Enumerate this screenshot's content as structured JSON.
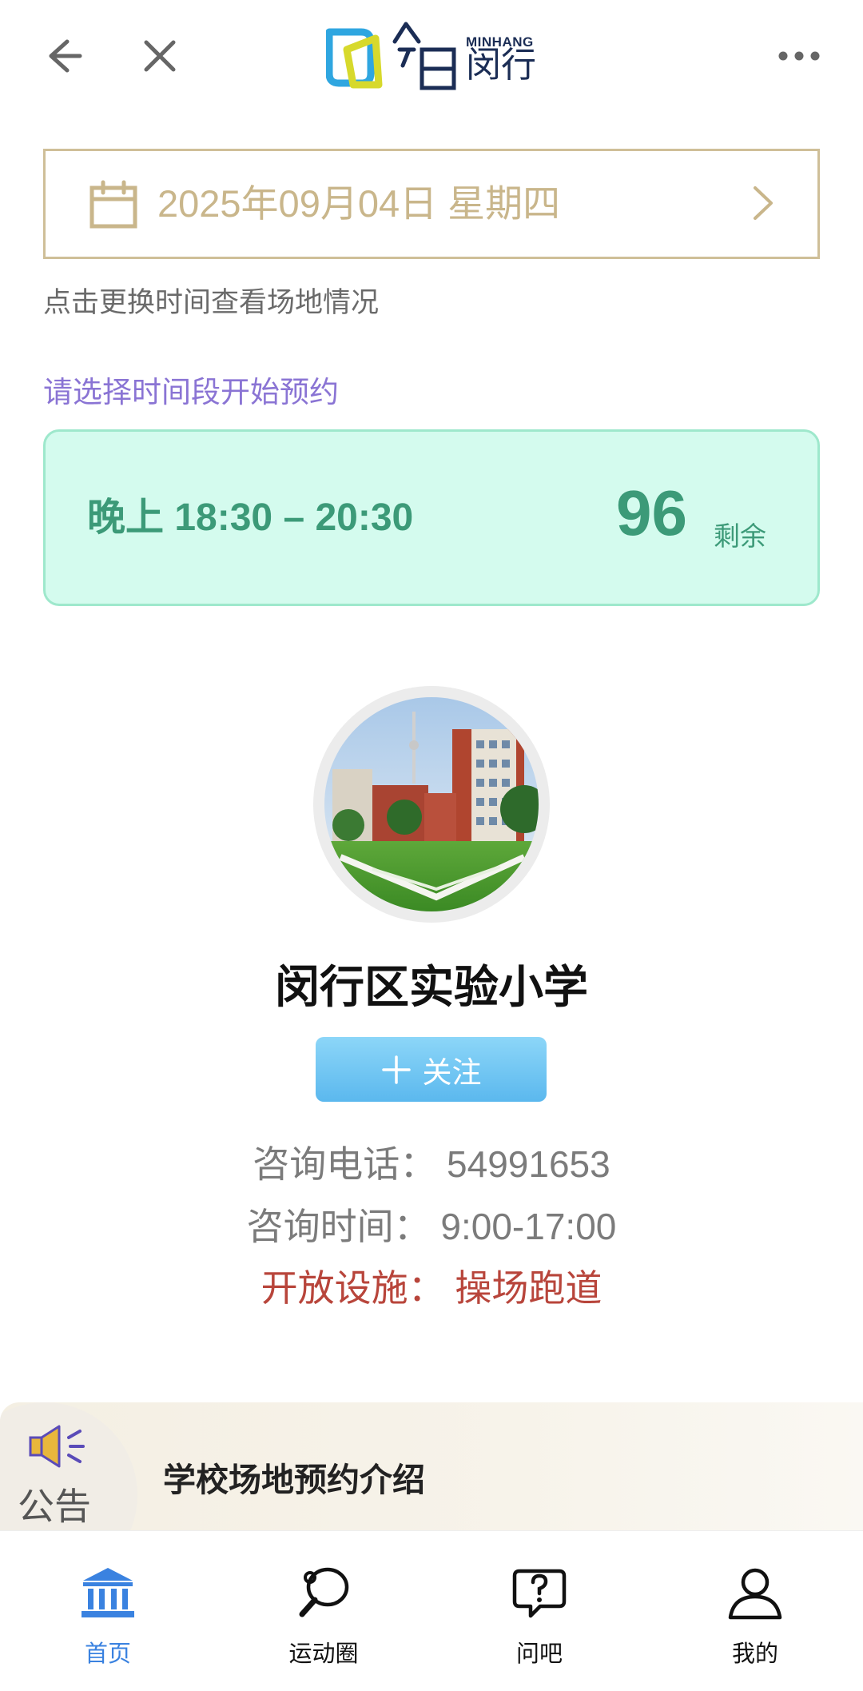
{
  "header": {
    "logo_en": "MINHANG",
    "logo_cn": "闵行",
    "back_icon": "arrow-left-icon",
    "close_icon": "close-icon",
    "more_icon": "more-dots-icon"
  },
  "date_selector": {
    "date_text": "2025年09月04日 星期四",
    "hint": "点击更换时间查看场地情况"
  },
  "booking": {
    "prompt": "请选择时间段开始预约",
    "slot": {
      "time": "晚上 18:30 – 20:30",
      "remaining_count": "96",
      "remaining_label": "剩余"
    }
  },
  "school": {
    "name": "闵行区实验小学",
    "follow_label": "关注",
    "phone": "咨询电话：  54991653",
    "hours": "咨询时间：  9:00-17:00",
    "facilities": "开放设施：  操场跑道"
  },
  "announcement": {
    "label": "公告",
    "text": "学校场地预约介绍",
    "icon": "speaker-icon"
  },
  "tabs": [
    {
      "label": "首页",
      "icon": "bank-icon",
      "active": true
    },
    {
      "label": "运动圈",
      "icon": "ping-pong-icon",
      "active": false
    },
    {
      "label": "问吧",
      "icon": "question-bubble-icon",
      "active": false
    },
    {
      "label": "我的",
      "icon": "user-icon",
      "active": false
    }
  ],
  "colors": {
    "accent_gold": "#c9b68b",
    "slot_green": "#3c9a78",
    "slot_bg": "#d4fbee",
    "prompt_purple": "#8a74d4",
    "facility_red": "#b8453b",
    "tab_active": "#3a82e0"
  }
}
